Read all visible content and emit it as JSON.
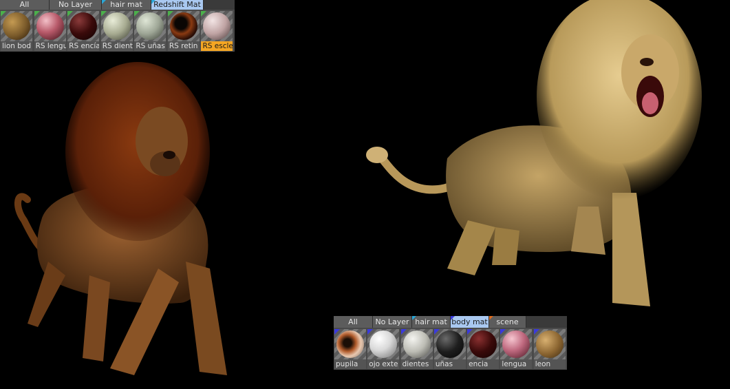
{
  "top_panel": {
    "tabs": [
      {
        "label": "All",
        "active": false,
        "marker": ""
      },
      {
        "label": "No Layer",
        "active": false,
        "marker": ""
      },
      {
        "label": "hair mat",
        "active": false,
        "marker": "#2aa7d8"
      },
      {
        "label": "Redshift Mat",
        "active": true,
        "marker": "#2aa7d8"
      }
    ],
    "materials": [
      {
        "label": "lion bod",
        "ball": "radial-gradient(circle at 35% 35%, #c49a52, #7a5a2a 55%, #2a1a08)",
        "corner": "#4bb04b"
      },
      {
        "label": "RS lengu",
        "ball": "radial-gradient(circle at 35% 30%, #f3c0c8, #b85a6a 45%, #3a1016)",
        "corner": "#4bb04b"
      },
      {
        "label": "RS encía",
        "ball": "radial-gradient(circle at 35% 30%, #8a3a3a, #3a0a0a 50%, #0e0202)",
        "corner": "#4bb04b"
      },
      {
        "label": "RS dient",
        "ball": "radial-gradient(circle at 35% 30%, #e8ecd8, #a8ac92 50%, #3e4034)",
        "corner": "#4bb04b"
      },
      {
        "label": "RS uñas",
        "ball": "radial-gradient(circle at 35% 30%, #dfe6d6, #9ea696 50%, #3a3e36)",
        "corner": "#4bb04b"
      },
      {
        "label": "RS retin",
        "ball": "radial-gradient(circle at 40% 40%, #0a0604 25%, #8a3a12 45%, #2a0e06 70%)",
        "corner": "#4bb04b"
      },
      {
        "label": "RS escle",
        "ball": "radial-gradient(circle at 35% 30%, #f2e4e4, #c0a4a4 50%, #4a3a3a)",
        "corner": "#4bb04b",
        "selected": true
      }
    ]
  },
  "bottom_panel": {
    "tabs": [
      {
        "label": "All",
        "active": false,
        "marker": ""
      },
      {
        "label": "No Layer",
        "active": false,
        "marker": ""
      },
      {
        "label": "hair mat",
        "active": false,
        "marker": "#2aa7d8"
      },
      {
        "label": "body mat",
        "active": true,
        "marker": "#3a3adc"
      },
      {
        "label": "scene",
        "active": false,
        "marker": "#e06a1a"
      }
    ],
    "materials": [
      {
        "label": "pupila",
        "ball": "radial-gradient(circle at 40% 45%, #1a0e06 18%, #b05a2a 38%, #e8c8b0 60%, #6a5a50)",
        "corner": "#3a3adc"
      },
      {
        "label": "ojo exte",
        "ball": "radial-gradient(circle at 35% 30%, #ffffff, #d8d8d8 45%, #707070)",
        "corner": "#3a3adc"
      },
      {
        "label": "dientes",
        "ball": "radial-gradient(circle at 35% 30%, #f4f4f0, #bcbcb4 50%, #4a4a46)",
        "corner": "#3a3adc"
      },
      {
        "label": "uñas",
        "ball": "radial-gradient(circle at 35% 30%, #6a6a6a, #1e1e1e 50%, #050505)",
        "corner": "#3a3adc"
      },
      {
        "label": "encia",
        "ball": "radial-gradient(circle at 35% 30%, #8a3030, #3a0a0a 50%, #120202)",
        "corner": "#3a3adc"
      },
      {
        "label": "lengua",
        "ball": "radial-gradient(circle at 35% 30%, #f6c6d0, #c06a80 45%, #4a1622)",
        "corner": "#3a3adc"
      },
      {
        "label": "leon",
        "ball": "radial-gradient(circle at 35% 35%, #d8b070, #8a6430 55%, #3a2810)",
        "corner": "#3a3adc"
      }
    ]
  },
  "scene": {
    "background": "#000000",
    "left_lion_fur": "#8a5426",
    "left_lion_mane": "#6a2a0a",
    "right_lion_fur": "#b0904e",
    "right_lion_mane": "#d4b878"
  }
}
